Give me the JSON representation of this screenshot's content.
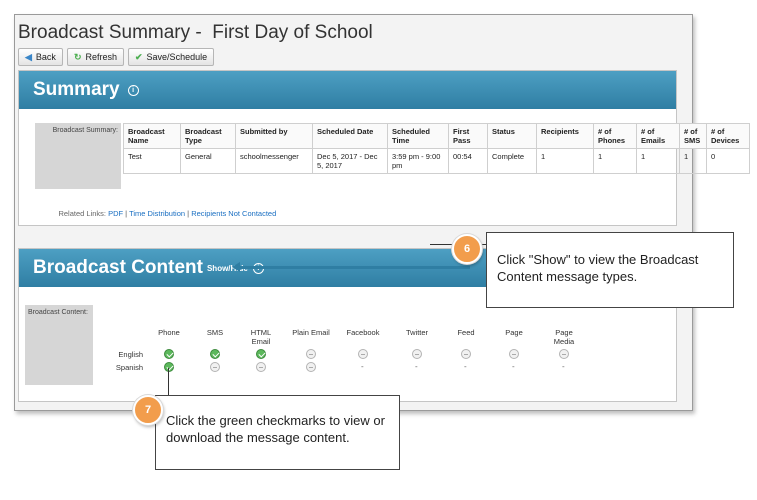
{
  "page": {
    "title": "Broadcast Summary -  First Day of School"
  },
  "toolbar": {
    "back": "Back",
    "refresh": "Refresh",
    "save": "Save/Schedule"
  },
  "summary": {
    "title": "Summary",
    "side_label": "Broadcast Summary:",
    "headers": [
      "Broadcast Name",
      "Broadcast Type",
      "Submitted by",
      "Scheduled Date",
      "Scheduled Time",
      "First Pass",
      "Status",
      "Recipients",
      "# of Phones",
      "# of Emails",
      "# of SMS",
      "# of Devices"
    ],
    "row": [
      "Test",
      "General",
      "schoolmessenger",
      "Dec 5, 2017 - Dec 5, 2017",
      "3:59 pm - 9:00 pm",
      "00:54",
      "Complete",
      "1",
      "1",
      "1",
      "1",
      "0"
    ],
    "related_label": "Related Links:",
    "links": [
      "PDF",
      "Time Distribution",
      "Recipients Not Contacted"
    ],
    "link_sep": " | "
  },
  "content": {
    "title": "Broadcast Content",
    "show_hide": "Show/Hide",
    "side_label": "Broadcast Content:",
    "columns": [
      "Phone",
      "SMS",
      "HTML Email",
      "Plain Email",
      "Facebook",
      "Twitter",
      "Feed",
      "Page",
      "Page Media"
    ],
    "rows": [
      {
        "lang": "English",
        "cells": [
          "on",
          "on",
          "on",
          "off",
          "off",
          "off",
          "off",
          "off",
          "off"
        ]
      },
      {
        "lang": "Spanish",
        "cells": [
          "on",
          "off",
          "off",
          "off",
          "-",
          "-",
          "-",
          "-",
          "-"
        ]
      }
    ]
  },
  "callouts": [
    {
      "step": "6",
      "text": "Click \"Show\" to view the Broadcast Content message types."
    },
    {
      "step": "7",
      "text": "Click the green checkmarks to view or download the message content."
    }
  ],
  "colors": {
    "header_blue": "#2f7ea3",
    "check_green": "#5cb85c",
    "step_orange": "#f29d4c"
  }
}
